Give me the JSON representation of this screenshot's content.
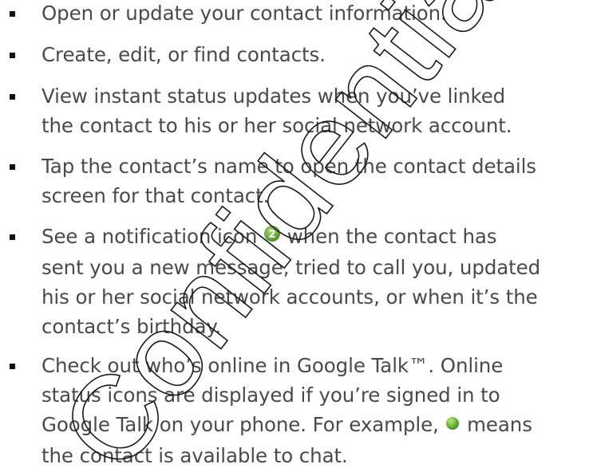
{
  "bullets": [
    {
      "lines": [
        "Open or update your contact information."
      ]
    },
    {
      "lines": [
        "Create, edit, or find contacts."
      ]
    },
    {
      "lines": [
        "View instant status updates when you’ve linked",
        "the contact to his or her social network account."
      ]
    },
    {
      "lines": [
        "Tap the contact’s name to open the contact details",
        "screen for that contact."
      ]
    },
    {
      "line1_before_icon": "See a notification icon ",
      "line1_after_icon": " when the contact has",
      "lines_rest": [
        "sent you a new message, tried to call you, updated",
        "his or her social network accounts, or when it’s the",
        "contact’s birthday."
      ],
      "icon": {
        "name": "notification-badge-icon",
        "text": "2",
        "color": "#6aa93a"
      }
    },
    {
      "lines_first": [
        "Check out who’s online in Google Talk™. Online",
        "status icons are displayed if you’re signed in to"
      ],
      "line3_before_icon": "Google Talk on your phone. For example, ",
      "line3_after_icon": " means",
      "lines_rest": [
        "the contact is available to chat."
      ],
      "icon": {
        "name": "online-status-icon",
        "color": "#5fb52a"
      }
    }
  ],
  "watermark": {
    "text": "Confidential",
    "color": "#1a1a1a"
  }
}
